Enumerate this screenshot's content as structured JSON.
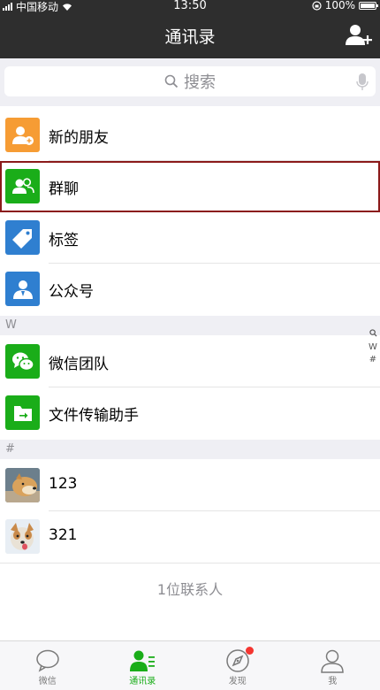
{
  "status_bar": {
    "carrier": "中国移动",
    "time": "13:50",
    "battery": "100%"
  },
  "nav": {
    "title": "通讯录",
    "add_icon": "add-friend-icon"
  },
  "search": {
    "placeholder": "搜索"
  },
  "top_items": [
    {
      "label": "新的朋友",
      "icon": "new-friends-icon",
      "color": "#f69c34"
    },
    {
      "label": "群聊",
      "icon": "group-chat-icon",
      "color": "#1aad19"
    },
    {
      "label": "标签",
      "icon": "tag-icon",
      "color": "#2f7fd0"
    },
    {
      "label": "公众号",
      "icon": "official-account-icon",
      "color": "#2f7fd0"
    }
  ],
  "sections": [
    {
      "header": "W",
      "items": [
        {
          "label": "微信团队",
          "icon": "wechat-team-icon",
          "color": "#1aad19"
        },
        {
          "label": "文件传输助手",
          "icon": "file-transfer-icon",
          "color": "#1aad19"
        }
      ]
    },
    {
      "header": "#",
      "items": [
        {
          "label": "123",
          "icon": "dog-avatar"
        },
        {
          "label": "321",
          "icon": "dog-avatar"
        }
      ]
    }
  ],
  "index_bar": [
    "W",
    "#"
  ],
  "footer": {
    "count": "1位联系人"
  },
  "tabs": [
    {
      "label": "微信",
      "icon": "chat-bubble-icon",
      "active": false
    },
    {
      "label": "通讯录",
      "icon": "contacts-icon",
      "active": true
    },
    {
      "label": "发现",
      "icon": "compass-icon",
      "active": false,
      "badge": true
    },
    {
      "label": "我",
      "icon": "profile-icon",
      "active": false
    }
  ],
  "colors": {
    "accent": "#1aad19",
    "nav_bg": "#2e2e2e",
    "badge": "#f43530"
  }
}
